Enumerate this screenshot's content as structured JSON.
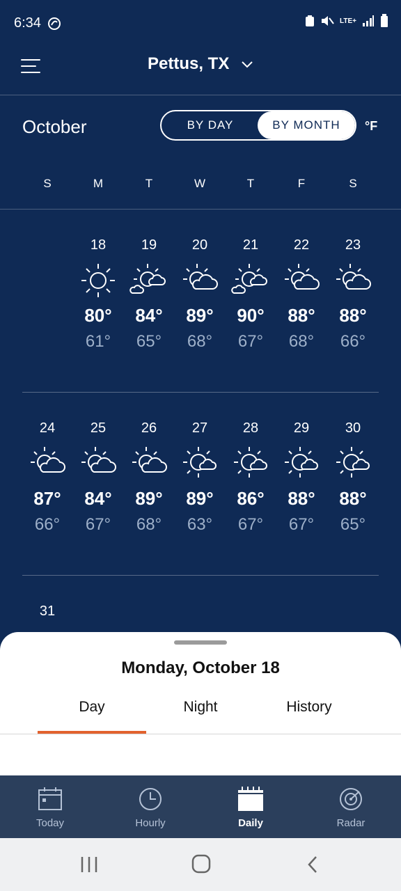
{
  "status_bar": {
    "time": "6:34",
    "network": "LTE+"
  },
  "header": {
    "location": "Pettus, TX"
  },
  "calendar": {
    "month": "October",
    "toggle": {
      "by_day": "BY DAY",
      "by_month": "BY MONTH",
      "selected": "BY MONTH"
    },
    "unit": "°F",
    "weekdays": [
      "S",
      "M",
      "T",
      "W",
      "T",
      "F",
      "S"
    ],
    "week1": [
      {
        "date": "18",
        "hi": "80°",
        "lo": "61°",
        "icon": "sunny-icon",
        "selected": true
      },
      {
        "date": "19",
        "hi": "84°",
        "lo": "65°",
        "icon": "partly-cloudy-icon"
      },
      {
        "date": "20",
        "hi": "89°",
        "lo": "68°",
        "icon": "mostly-cloudy-icon"
      },
      {
        "date": "21",
        "hi": "90°",
        "lo": "67°",
        "icon": "partly-cloudy-icon"
      },
      {
        "date": "22",
        "hi": "88°",
        "lo": "68°",
        "icon": "mostly-cloudy-icon"
      },
      {
        "date": "23",
        "hi": "88°",
        "lo": "66°",
        "icon": "mostly-cloudy-icon"
      }
    ],
    "week2": [
      {
        "date": "24",
        "hi": "87°",
        "lo": "66°",
        "icon": "mostly-cloudy-icon"
      },
      {
        "date": "25",
        "hi": "84°",
        "lo": "67°",
        "icon": "mostly-cloudy-icon"
      },
      {
        "date": "26",
        "hi": "89°",
        "lo": "68°",
        "icon": "mostly-cloudy-icon"
      },
      {
        "date": "27",
        "hi": "89°",
        "lo": "63°",
        "icon": "partly-cloudy-icon"
      },
      {
        "date": "28",
        "hi": "86°",
        "lo": "67°",
        "icon": "partly-cloudy-icon"
      },
      {
        "date": "29",
        "hi": "88°",
        "lo": "67°",
        "icon": "partly-cloudy-icon"
      },
      {
        "date": "30",
        "hi": "88°",
        "lo": "65°",
        "icon": "partly-cloudy-icon"
      }
    ],
    "week3": [
      {
        "date": "31"
      }
    ]
  },
  "detail_sheet": {
    "title": "Monday, October 18",
    "tabs": [
      "Day",
      "Night",
      "History"
    ],
    "active_tab": "Day",
    "accent": "#e2622e"
  },
  "bottom_nav": {
    "items": [
      {
        "label": "Today",
        "icon": "calendar-today-icon"
      },
      {
        "label": "Hourly",
        "icon": "clock-icon"
      },
      {
        "label": "Daily",
        "icon": "calendar-daily-icon"
      },
      {
        "label": "Radar",
        "icon": "radar-icon"
      }
    ],
    "active": "Daily"
  },
  "colors": {
    "background": "#0f2a55",
    "nav": "#2b3f5c",
    "low_temp": "#9eb0c9"
  }
}
